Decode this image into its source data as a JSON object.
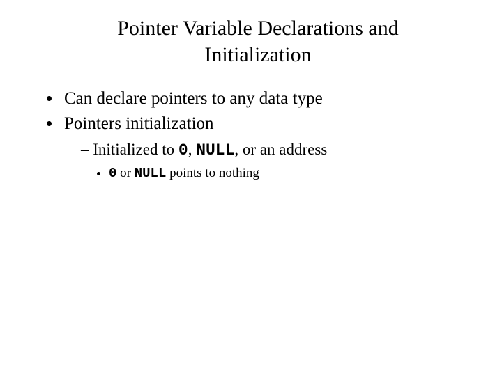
{
  "title": "Pointer Variable Declarations and Initialization",
  "bullets": {
    "b1": "Can declare pointers to any data type",
    "b2": "Pointers initialization",
    "sub1_pre": "Initialized to ",
    "sub1_code1": "0",
    "sub1_mid": ", ",
    "sub1_code2": "NULL",
    "sub1_post": ", or an address",
    "sub2_code1": "0",
    "sub2_mid": " or ",
    "sub2_code2": "NULL",
    "sub2_post": " points to nothing"
  }
}
